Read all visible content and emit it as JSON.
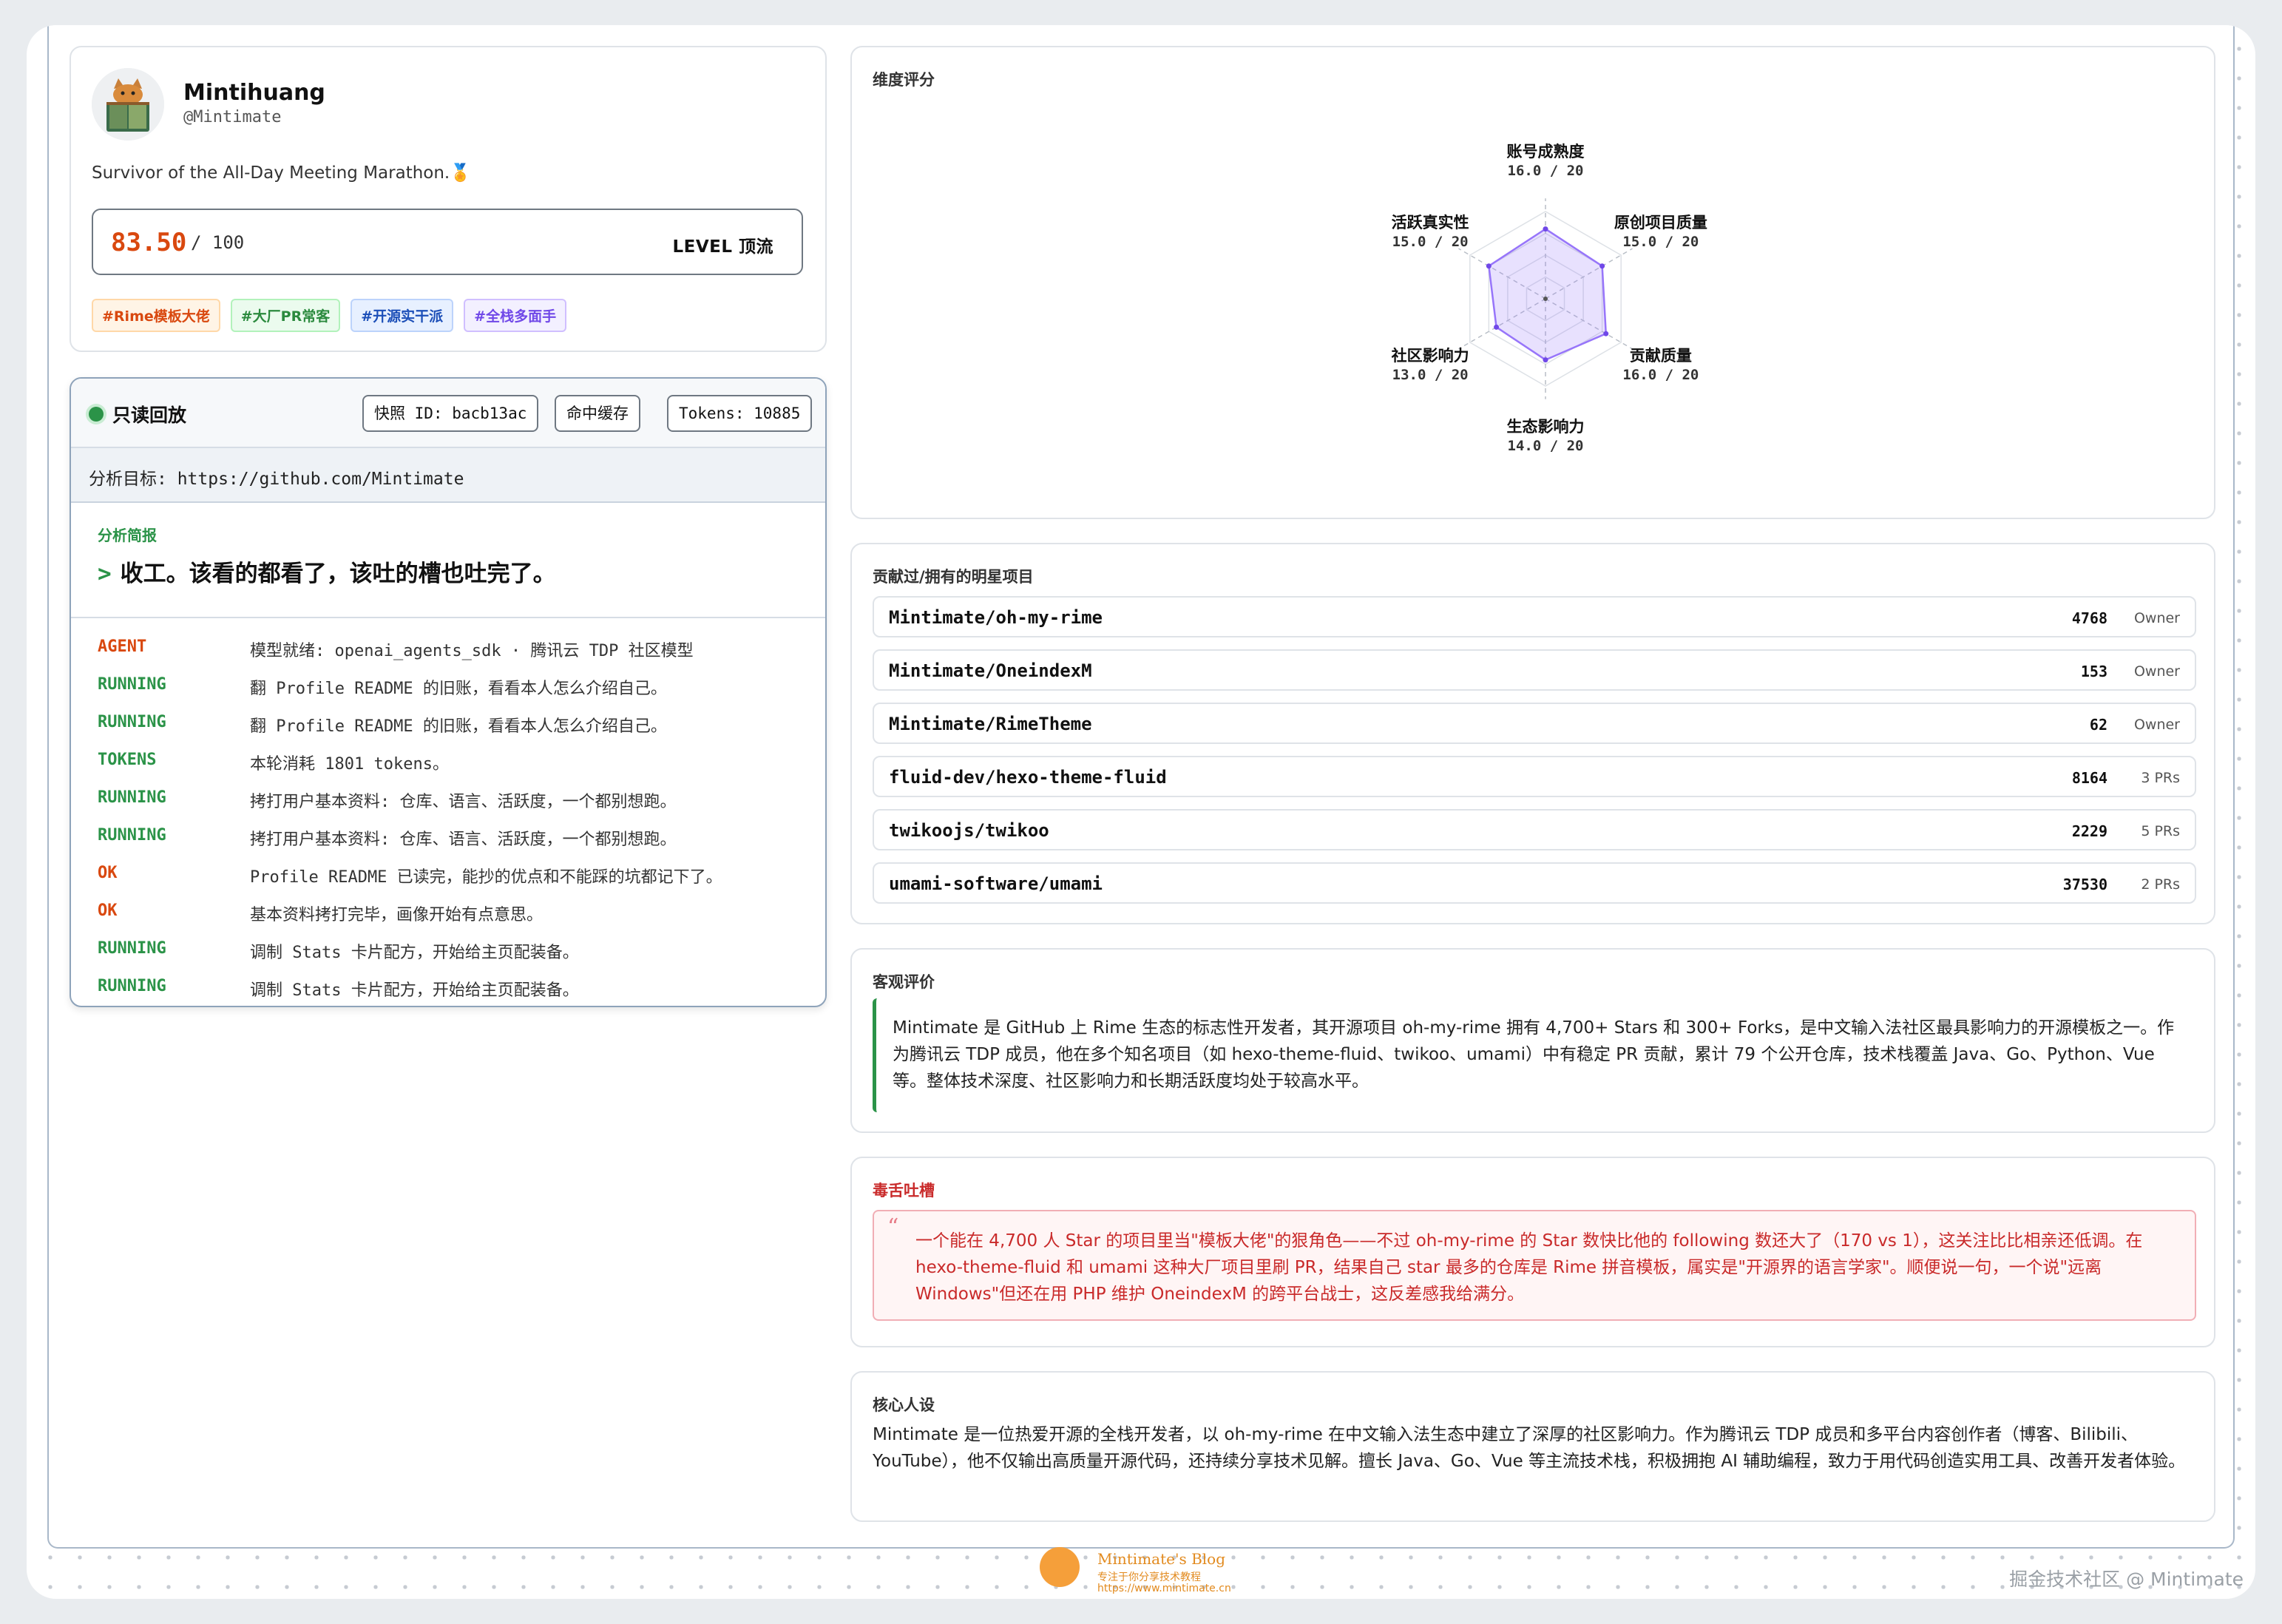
{
  "profile": {
    "name": "Mintihuang",
    "handle": "@Mintimate",
    "bio": "Survivor of the All-Day Meeting Marathon.🏅",
    "score": "83.50",
    "score_max": "/ 100",
    "level": "LEVEL 顶流",
    "tags": [
      {
        "label": "#Rime模板大佬",
        "color": "#d9480f",
        "bg": "#fff4e6",
        "border": "#ffd8a8"
      },
      {
        "label": "#大厂PR常客",
        "color": "#2b8a3e",
        "bg": "#ebfbee",
        "border": "#b2f2bb"
      },
      {
        "label": "#开源实干派",
        "color": "#1c4fb8",
        "bg": "#e7f0ff",
        "border": "#bcd3fb"
      },
      {
        "label": "#全栈多面手",
        "color": "#7048e8",
        "bg": "#f3f0ff",
        "border": "#d0bfff"
      }
    ]
  },
  "terminal": {
    "status": "只读回放",
    "snapshot": "快照 ID: bacb13ac",
    "cache": "命中缓存",
    "tokens": "Tokens: 10885",
    "target": "分析目标: https://github.com/Mintimate",
    "brief_label": "分析简报",
    "brief_prompt": ">",
    "brief_text": "收工。该看的都看了，该吐的槽也吐完了。",
    "logs": [
      {
        "k": "AGENT",
        "v": "模型就绪: openai_agents_sdk · 腾讯云 TDP 社区模型",
        "c": "#d9480f"
      },
      {
        "k": "RUNNING",
        "v": "翻 Profile README 的旧账，看看本人怎么介绍自己。",
        "c": "#2b9348"
      },
      {
        "k": "RUNNING",
        "v": "翻 Profile README 的旧账，看看本人怎么介绍自己。",
        "c": "#2b9348"
      },
      {
        "k": "TOKENS",
        "v": "本轮消耗 1801 tokens。",
        "c": "#2b9348"
      },
      {
        "k": "RUNNING",
        "v": "拷打用户基本资料: 仓库、语言、活跃度，一个都别想跑。",
        "c": "#2b9348"
      },
      {
        "k": "RUNNING",
        "v": "拷打用户基本资料: 仓库、语言、活跃度，一个都别想跑。",
        "c": "#2b9348"
      },
      {
        "k": "OK",
        "v": "Profile README 已读完，能抄的优点和不能踩的坑都记下了。",
        "c": "#d9480f"
      },
      {
        "k": "OK",
        "v": "基本资料拷打完毕，画像开始有点意思。",
        "c": "#d9480f"
      },
      {
        "k": "RUNNING",
        "v": "调制 Stats 卡片配方，开始给主页配装备。",
        "c": "#2b9348"
      },
      {
        "k": "RUNNING",
        "v": "调制 Stats 卡片配方，开始给主页配装备。",
        "c": "#2b9348"
      }
    ]
  },
  "radar": {
    "title": "维度评分",
    "max": 20,
    "dims": [
      {
        "name": "账号成熟度",
        "value": 16.0,
        "text": "16.0 / 20"
      },
      {
        "name": "原创项目质量",
        "value": 15.0,
        "text": "15.0 / 20"
      },
      {
        "name": "贡献质量",
        "value": 16.0,
        "text": "16.0 / 20"
      },
      {
        "name": "生态影响力",
        "value": 14.0,
        "text": "14.0 / 20"
      },
      {
        "name": "社区影响力",
        "value": 13.0,
        "text": "13.0 / 20"
      },
      {
        "name": "活跃真实性",
        "value": 15.0,
        "text": "15.0 / 20"
      }
    ]
  },
  "repos": {
    "title": "贡献过/拥有的明星项目",
    "items": [
      {
        "name": "Mintimate/oh-my-rime",
        "stars": "4768",
        "role": "Owner"
      },
      {
        "name": "Mintimate/OneindexM",
        "stars": "153",
        "role": "Owner"
      },
      {
        "name": "Mintimate/RimeTheme",
        "stars": "62",
        "role": "Owner"
      },
      {
        "name": "fluid-dev/hexo-theme-fluid",
        "stars": "8164",
        "role": "3 PRs"
      },
      {
        "name": "twikoojs/twikoo",
        "stars": "2229",
        "role": "5 PRs"
      },
      {
        "name": "umami-software/umami",
        "stars": "37530",
        "role": "2 PRs"
      }
    ]
  },
  "review": {
    "title": "客观评价",
    "text": "Mintimate 是 GitHub 上 Rime 生态的标志性开发者，其开源项目 oh-my-rime 拥有 4,700+ Stars 和 300+ Forks，是中文输入法社区最具影响力的开源模板之一。作为腾讯云 TDP 成员，他在多个知名项目（如 hexo-theme-fluid、twikoo、umami）中有稳定 PR 贡献，累计 79 个公开仓库，技术栈覆盖 Java、Go、Python、Vue 等。整体技术深度、社区影响力和长期活跃度均处于较高水平。"
  },
  "roast": {
    "title": "毒舌吐槽",
    "quote": "“",
    "text": "一个能在 4,700 人 Star 的项目里当\"模板大佬\"的狠角色——不过 oh-my-rime 的 Star 数快比他的 following 数还大了（170 vs 1），这关注比比相亲还低调。在 hexo-theme-fluid 和 umami 这种大厂项目里刷 PR，结果自己 star 最多的仓库是 Rime 拼音模板，属实是\"开源界的语言学家\"。顺便说一句，一个说\"远离 Windows\"但还在用 PHP 维护 OneindexM 的跨平台战士，这反差感我给满分。"
  },
  "persona": {
    "title": "核心人设",
    "text": "Mintimate 是一位热爱开源的全栈开发者，以 oh-my-rime 在中文输入法生态中建立了深厚的社区影响力。作为腾讯云 TDP 成员和多平台内容创作者（博客、Bilibili、YouTube），他不仅输出高质量开源代码，还持续分享技术见解。擅长 Java、Go、Vue 等主流技术栈，积极拥抱 AI 辅助编程，致力于用代码创造实用工具、改善开发者体验。"
  },
  "footer": {
    "blog_name": "Mintimate's Blog",
    "blog_sub": "专注于你分享技术教程",
    "blog_url": "https://www.mintimate.cn",
    "watermark": "掘金技术社区 @ Mintimate"
  }
}
